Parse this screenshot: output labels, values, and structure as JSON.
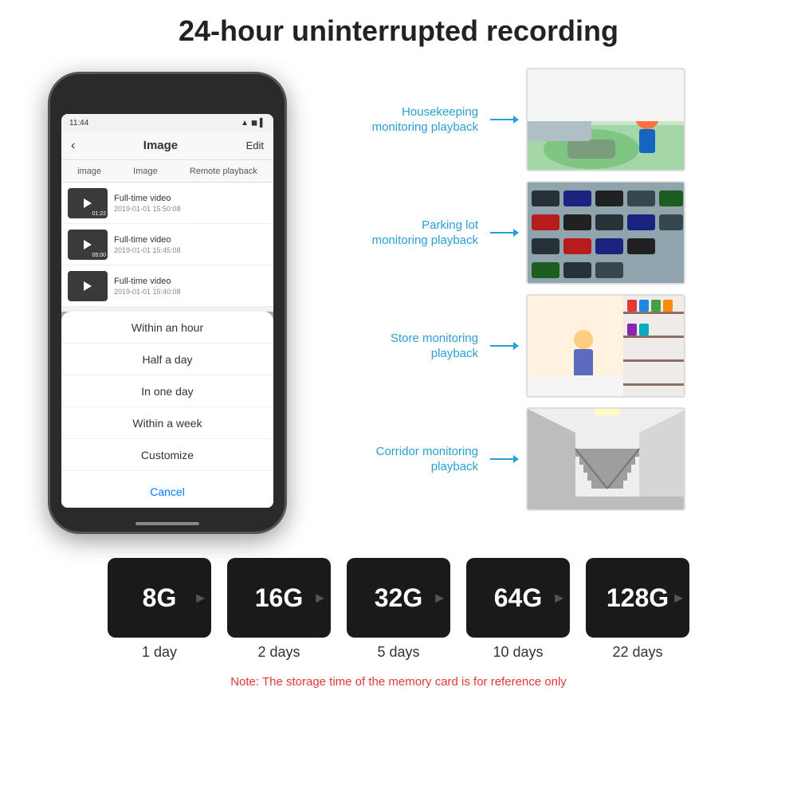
{
  "header": {
    "title": "24-hour uninterrupted recording"
  },
  "phone": {
    "status_time": "11:44",
    "nav_back": "‹",
    "nav_title": "Image",
    "nav_edit": "Edit",
    "tabs": [
      "image",
      "Image",
      "Remote playback"
    ],
    "videos": [
      {
        "name": "Full-time video",
        "date": "2019-01-01 15:50:08",
        "duration": "01:22"
      },
      {
        "name": "Full-time video",
        "date": "2019-01-01 15:45:08",
        "duration": "05:00"
      },
      {
        "name": "Full-time video",
        "date": "2019-01-01 15:40:08",
        "duration": ""
      }
    ],
    "dropdown": {
      "items": [
        "Within an hour",
        "Half a day",
        "In one day",
        "Within a week",
        "Customize"
      ],
      "cancel_label": "Cancel"
    }
  },
  "monitoring": {
    "items": [
      {
        "label": "Housekeeping\nmonitoring playback",
        "img_class": "img-housekeeping"
      },
      {
        "label": "Parking lot\nmonitoring playback",
        "img_class": "img-parking"
      },
      {
        "label": "Store monitoring\nplayback",
        "img_class": "img-store"
      },
      {
        "label": "Corridor monitoring\nplayback",
        "img_class": "img-corridor"
      }
    ]
  },
  "sdcards": [
    {
      "size": "8G",
      "days": "1 day"
    },
    {
      "size": "16G",
      "days": "2 days"
    },
    {
      "size": "32G",
      "days": "5 days"
    },
    {
      "size": "64G",
      "days": "10 days"
    },
    {
      "size": "128G",
      "days": "22 days"
    }
  ],
  "note": "Note: The storage time of the memory card is for reference only"
}
